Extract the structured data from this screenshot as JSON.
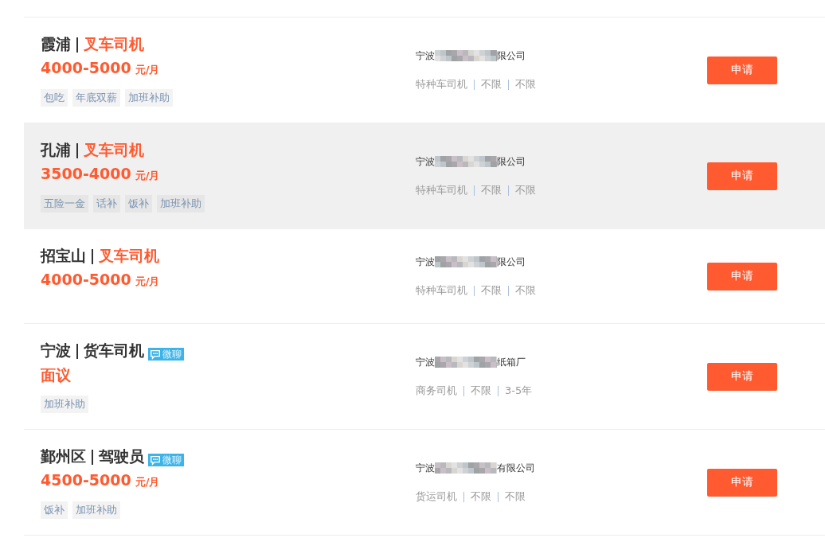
{
  "jobs": [
    {
      "location": "霞浦",
      "job": "叉车司机",
      "job_highlighted": true,
      "salary": "4000-5000",
      "salary_unit": "元/月",
      "tags": [
        "包吃",
        "年底双薪",
        "加班补助"
      ],
      "company_start": "宁波",
      "company_end": "限公司",
      "info": [
        "特种车司机",
        "不限",
        "不限"
      ],
      "apply": "申请",
      "hovered": false
    },
    {
      "location": "孔浦",
      "job": "叉车司机",
      "job_highlighted": true,
      "salary": "3500-4000",
      "salary_unit": "元/月",
      "tags": [
        "五险一金",
        "话补",
        "饭补",
        "加班补助"
      ],
      "company_start": "宁波",
      "company_end": "限公司",
      "info": [
        "特种车司机",
        "不限",
        "不限"
      ],
      "apply": "申请",
      "hovered": true
    },
    {
      "location": "招宝山",
      "job": "叉车司机",
      "job_highlighted": true,
      "salary": "4000-5000",
      "salary_unit": "元/月",
      "company_start": "宁波",
      "company_end": "限公司",
      "info": [
        "特种车司机",
        "不限",
        "不限"
      ],
      "apply": "申请",
      "hovered": false
    },
    {
      "location": "宁波",
      "job": "货车司机",
      "job_highlighted": false,
      "chat_badge": "微聊",
      "salary": "面议",
      "tags": [
        "加班补助"
      ],
      "company_start": "宁波",
      "company_end": "纸箱厂",
      "info": [
        "商务司机",
        "不限",
        "3-5年"
      ],
      "apply": "申请",
      "hovered": false
    },
    {
      "location": "鄞州区",
      "job": "驾驶员",
      "job_highlighted": false,
      "chat_badge": "微聊",
      "salary": "4500-5000",
      "salary_unit": "元/月",
      "tags": [
        "饭补",
        "加班补助"
      ],
      "company_start": "宁波",
      "company_end": "有限公司",
      "info": [
        "货运司机",
        "不限",
        "不限"
      ],
      "apply": "申请",
      "hovered": false
    }
  ]
}
